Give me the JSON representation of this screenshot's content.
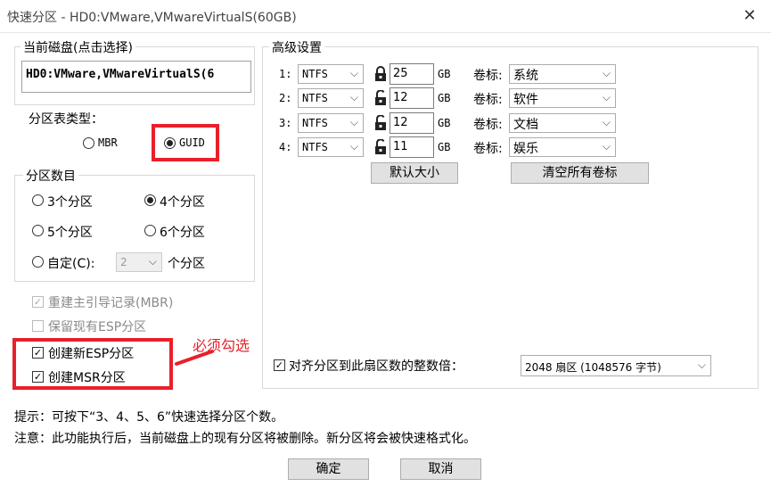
{
  "window": {
    "title": "快速分区 - HD0:VMware,VMwareVirtualS(60GB)",
    "close_glyph": "✕"
  },
  "disk": {
    "label": "当前磁盘(点击选择)",
    "value": "HD0:VMware,VMwareVirtualS(6"
  },
  "partition_table": {
    "label": "分区表类型：",
    "mbr": "MBR",
    "guid": "GUID",
    "selected": "GUID"
  },
  "partition_count": {
    "label": "分区数目",
    "options": [
      "3个分区",
      "4个分区",
      "5个分区",
      "6个分区"
    ],
    "selected": "4个分区",
    "custom_label": "自定(C):",
    "custom_value": "2",
    "custom_suffix": "个分区"
  },
  "options": {
    "rebuild_mbr": "重建主引导记录(MBR)",
    "keep_esp": "保留现有ESP分区",
    "create_esp": "创建新ESP分区",
    "create_msr": "创建MSR分区"
  },
  "annotation": "必须勾选",
  "advanced": {
    "label": "高级设置",
    "unit": "GB",
    "vol_label": "卷标:",
    "rows": [
      {
        "num": "1:",
        "fs": "NTFS",
        "size": "25",
        "volume": "系统",
        "locked": true
      },
      {
        "num": "2:",
        "fs": "NTFS",
        "size": "12",
        "volume": "软件",
        "locked": false
      },
      {
        "num": "3:",
        "fs": "NTFS",
        "size": "12",
        "volume": "文档",
        "locked": false
      },
      {
        "num": "4:",
        "fs": "NTFS",
        "size": "11",
        "volume": "娱乐",
        "locked": false
      }
    ],
    "default_size_btn": "默认大小",
    "clear_labels_btn": "清空所有卷标",
    "align_label": "对齐分区到此扇区数的整数倍：",
    "align_value": "2048 扇区 (1048576 字节)"
  },
  "hints": {
    "tip": "提示：可按下“3、4、5、6”快速选择分区个数。",
    "note": "注意：此功能执行后，当前磁盘上的现有分区将被删除。新分区将会被快速格式化。"
  },
  "buttons": {
    "ok": "确定",
    "cancel": "取消"
  },
  "colors": {
    "accent_red": "#e8202a",
    "annotation_red": "#e8202a"
  }
}
